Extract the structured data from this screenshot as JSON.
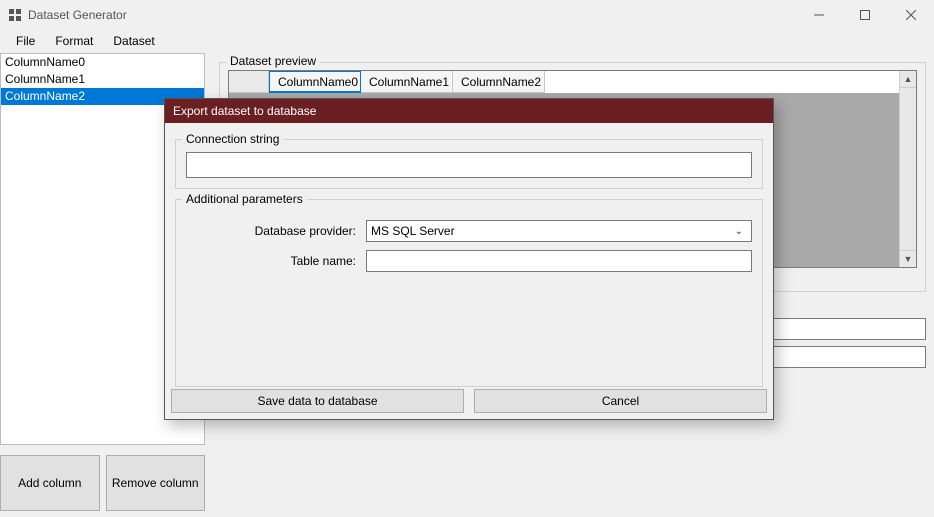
{
  "window": {
    "title": "Dataset Generator"
  },
  "menu": {
    "file": "File",
    "format": "Format",
    "dataset": "Dataset"
  },
  "columns": [
    "ColumnName0",
    "ColumnName1",
    "ColumnName2"
  ],
  "selected_column_index": 2,
  "left_buttons": {
    "add": "Add column",
    "remove": "Remove column"
  },
  "preview": {
    "group_label": "Dataset preview",
    "headers": [
      "ColumnName0",
      "ColumnName1",
      "ColumnName2"
    ]
  },
  "dialog": {
    "title": "Export dataset to database",
    "conn_group": "Connection string",
    "conn_value": "",
    "params_group": "Additional parameters",
    "provider_label": "Database provider:",
    "provider_value": "MS SQL Server",
    "table_label": "Table name:",
    "table_value": "",
    "save": "Save data to database",
    "cancel": "Cancel"
  }
}
